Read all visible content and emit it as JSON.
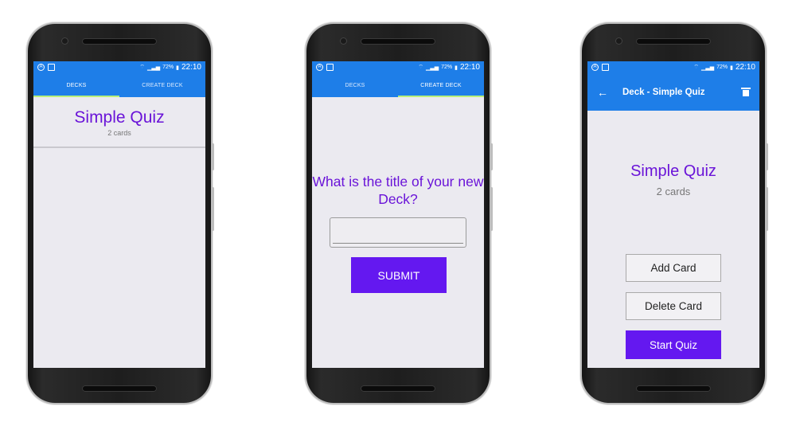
{
  "status_bar": {
    "battery": "72%",
    "time": "22:10"
  },
  "screen1": {
    "tabs": [
      {
        "label": "DECKS"
      },
      {
        "label": "CREATE DECK"
      }
    ],
    "deck": {
      "title": "Simple Quiz",
      "count": "2 cards"
    }
  },
  "screen2": {
    "tabs": [
      {
        "label": "DECKS"
      },
      {
        "label": "CREATE DECK"
      }
    ],
    "question": "What is the title of your new Deck?",
    "input_value": "",
    "submit_label": "SUBMIT"
  },
  "screen3": {
    "appbar_title": "Deck - Simple Quiz",
    "back_icon": "←",
    "deck": {
      "title": "Simple Quiz",
      "count": "2 cards"
    },
    "add_card_label": "Add Card",
    "delete_card_label": "Delete Card",
    "start_quiz_label": "Start Quiz"
  },
  "colors": {
    "primary": "#1e7ee8",
    "accent": "#6418f0",
    "title": "#6a14d8",
    "tab_indicator": "#b9f07a",
    "background": "#ebeaf0"
  },
  "icons": [
    "back-arrow-icon",
    "trash-icon",
    "wifi-icon",
    "signal-icon",
    "battery-icon"
  ]
}
